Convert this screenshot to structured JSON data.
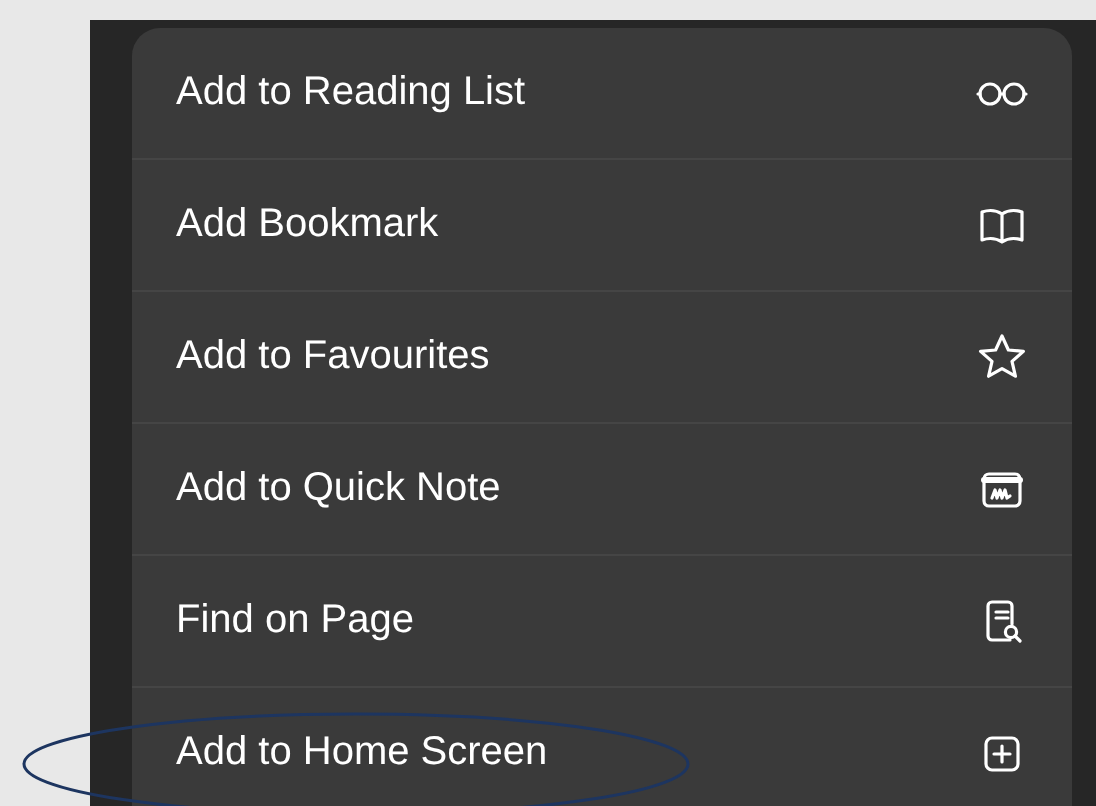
{
  "menu": {
    "items": [
      {
        "label": "Add to Reading List"
      },
      {
        "label": "Add Bookmark"
      },
      {
        "label": "Add to Favourites"
      },
      {
        "label": "Add to Quick Note"
      },
      {
        "label": "Find on Page"
      },
      {
        "label": "Add to Home Screen"
      }
    ]
  }
}
